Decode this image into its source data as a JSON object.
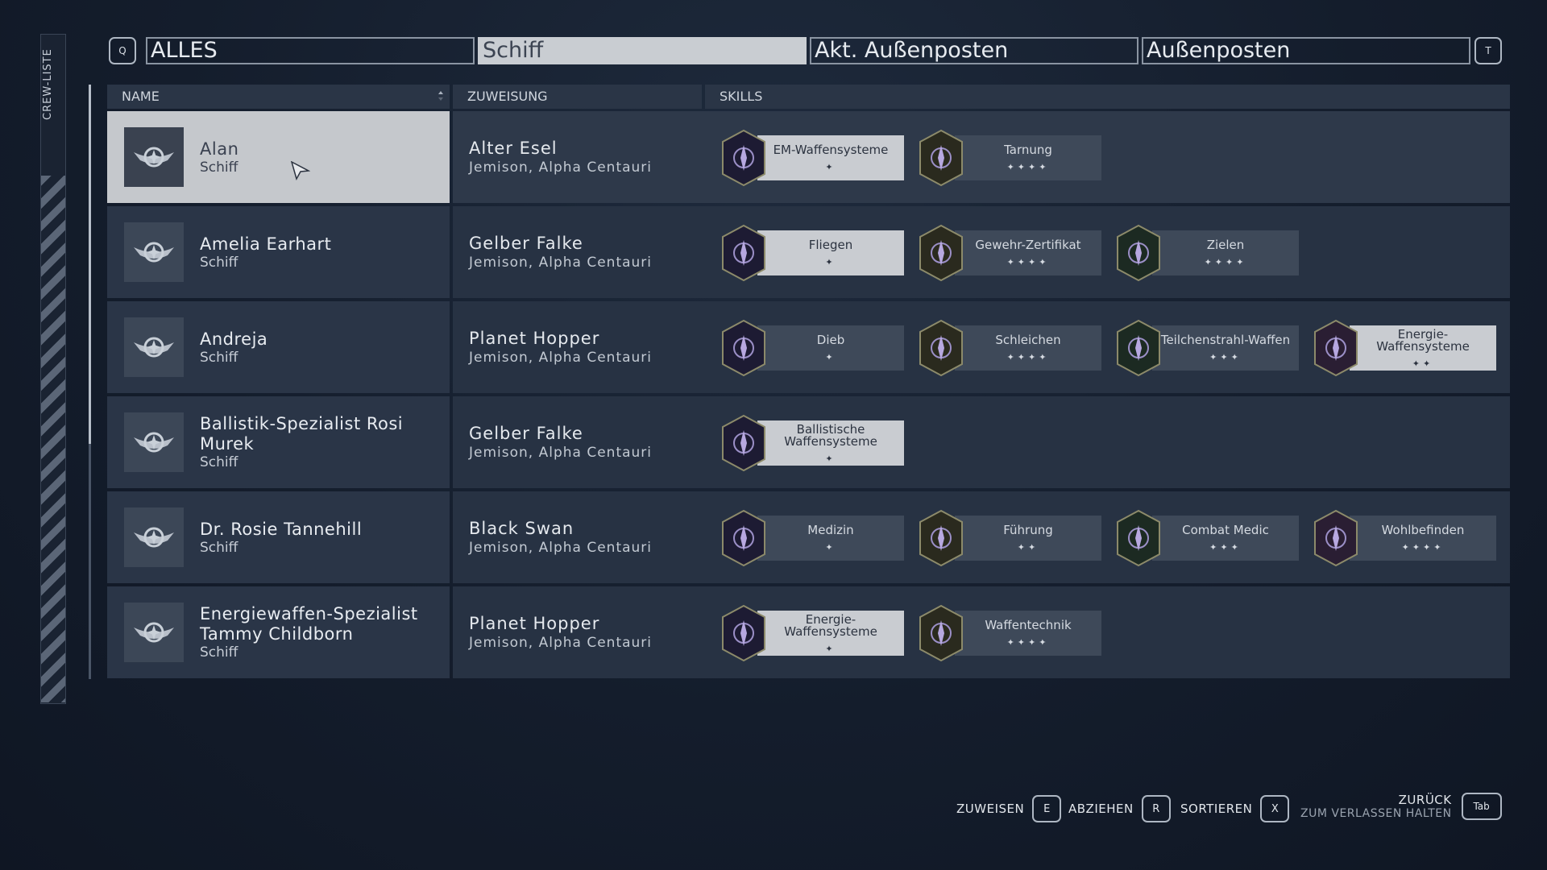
{
  "sidebar": {
    "label": "CREW-LISTE"
  },
  "tabs": {
    "prev_key": "Q",
    "next_key": "T",
    "items": [
      {
        "label": "ALLES",
        "active": false
      },
      {
        "label": "Schiff",
        "active": true
      },
      {
        "label": "Akt. Außenposten",
        "active": false
      },
      {
        "label": "Außenposten",
        "active": false
      }
    ]
  },
  "table": {
    "headers": {
      "name": "NAME",
      "assignment": "ZUWEISUNG",
      "skills": "SKILLS"
    },
    "rows": [
      {
        "name": "Alan",
        "sub": "Schiff",
        "ship": "Alter Esel",
        "location": "Jemison, Alpha Centauri",
        "selected": true,
        "skills": [
          {
            "name": "EM-Waffensysteme",
            "rank": "✦",
            "icon": "em-weapons-icon",
            "lit": true
          },
          {
            "name": "Tarnung",
            "rank": "✦✦✦✦",
            "icon": "stealth-icon",
            "lit": false
          }
        ]
      },
      {
        "name": "Amelia Earhart",
        "sub": "Schiff",
        "ship": "Gelber Falke",
        "location": "Jemison, Alpha Centauri",
        "skills": [
          {
            "name": "Fliegen",
            "rank": "✦",
            "icon": "piloting-icon",
            "lit": true
          },
          {
            "name": "Gewehr-Zertifikat",
            "rank": "✦✦✦✦",
            "icon": "rifle-cert-icon",
            "lit": false
          },
          {
            "name": "Zielen",
            "rank": "✦✦✦✦",
            "icon": "targeting-icon",
            "lit": false
          }
        ]
      },
      {
        "name": "Andreja",
        "sub": "Schiff",
        "ship": "Planet Hopper",
        "location": "Jemison, Alpha Centauri",
        "skills": [
          {
            "name": "Dieb",
            "rank": "✦",
            "icon": "thief-icon",
            "lit": false
          },
          {
            "name": "Schleichen",
            "rank": "✦✦✦✦",
            "icon": "sneak-icon",
            "lit": false
          },
          {
            "name": "Teilchenstrahl-Waffen",
            "rank": "✦✦✦",
            "icon": "particle-beam-icon",
            "lit": false
          },
          {
            "name": "Energie-Waffensysteme",
            "rank": "✦✦",
            "icon": "energy-weapons-icon",
            "lit": true
          }
        ]
      },
      {
        "name": "Ballistik-Spezialist Rosi Murek",
        "sub": "Schiff",
        "ship": "Gelber Falke",
        "location": "Jemison, Alpha Centauri",
        "skills": [
          {
            "name": "Ballistische Waffensysteme",
            "rank": "✦",
            "icon": "ballistic-weapons-icon",
            "lit": true
          }
        ]
      },
      {
        "name": "Dr. Rosie Tannehill",
        "sub": "Schiff",
        "ship": "Black Swan",
        "location": "Jemison, Alpha Centauri",
        "skills": [
          {
            "name": "Medizin",
            "rank": "✦",
            "icon": "medicine-icon",
            "lit": false
          },
          {
            "name": "Führung",
            "rank": "✦✦",
            "icon": "leadership-icon",
            "lit": false
          },
          {
            "name": "Combat Medic",
            "rank": "✦✦✦",
            "icon": "combat-medic-icon",
            "lit": false
          },
          {
            "name": "Wohlbefinden",
            "rank": "✦✦✦✦",
            "icon": "wellness-icon",
            "lit": false
          }
        ]
      },
      {
        "name": "Energiewaffen-Spezialist Tammy Childborn",
        "sub": "Schiff",
        "ship": "Planet Hopper",
        "location": "Jemison, Alpha Centauri",
        "skills": [
          {
            "name": "Energie-Waffensysteme",
            "rank": "✦",
            "icon": "energy-weapons-icon",
            "lit": true
          },
          {
            "name": "Waffentechnik",
            "rank": "✦✦✦✦",
            "icon": "weapon-engineering-icon",
            "lit": false
          }
        ]
      }
    ]
  },
  "footer": {
    "assign_label": "ZUWEISEN",
    "assign_key": "E",
    "remove_label": "ABZIEHEN",
    "remove_key": "R",
    "sort_label": "SORTIEREN",
    "sort_key": "X",
    "back_label": "ZURÜCK",
    "back_hint": "ZUM VERLASSEN HALTEN",
    "back_key": "Tab"
  },
  "colors": {
    "selected_row": "#c5c8cc",
    "background": "#141d2c",
    "tab_active": "#c9cdd2"
  }
}
